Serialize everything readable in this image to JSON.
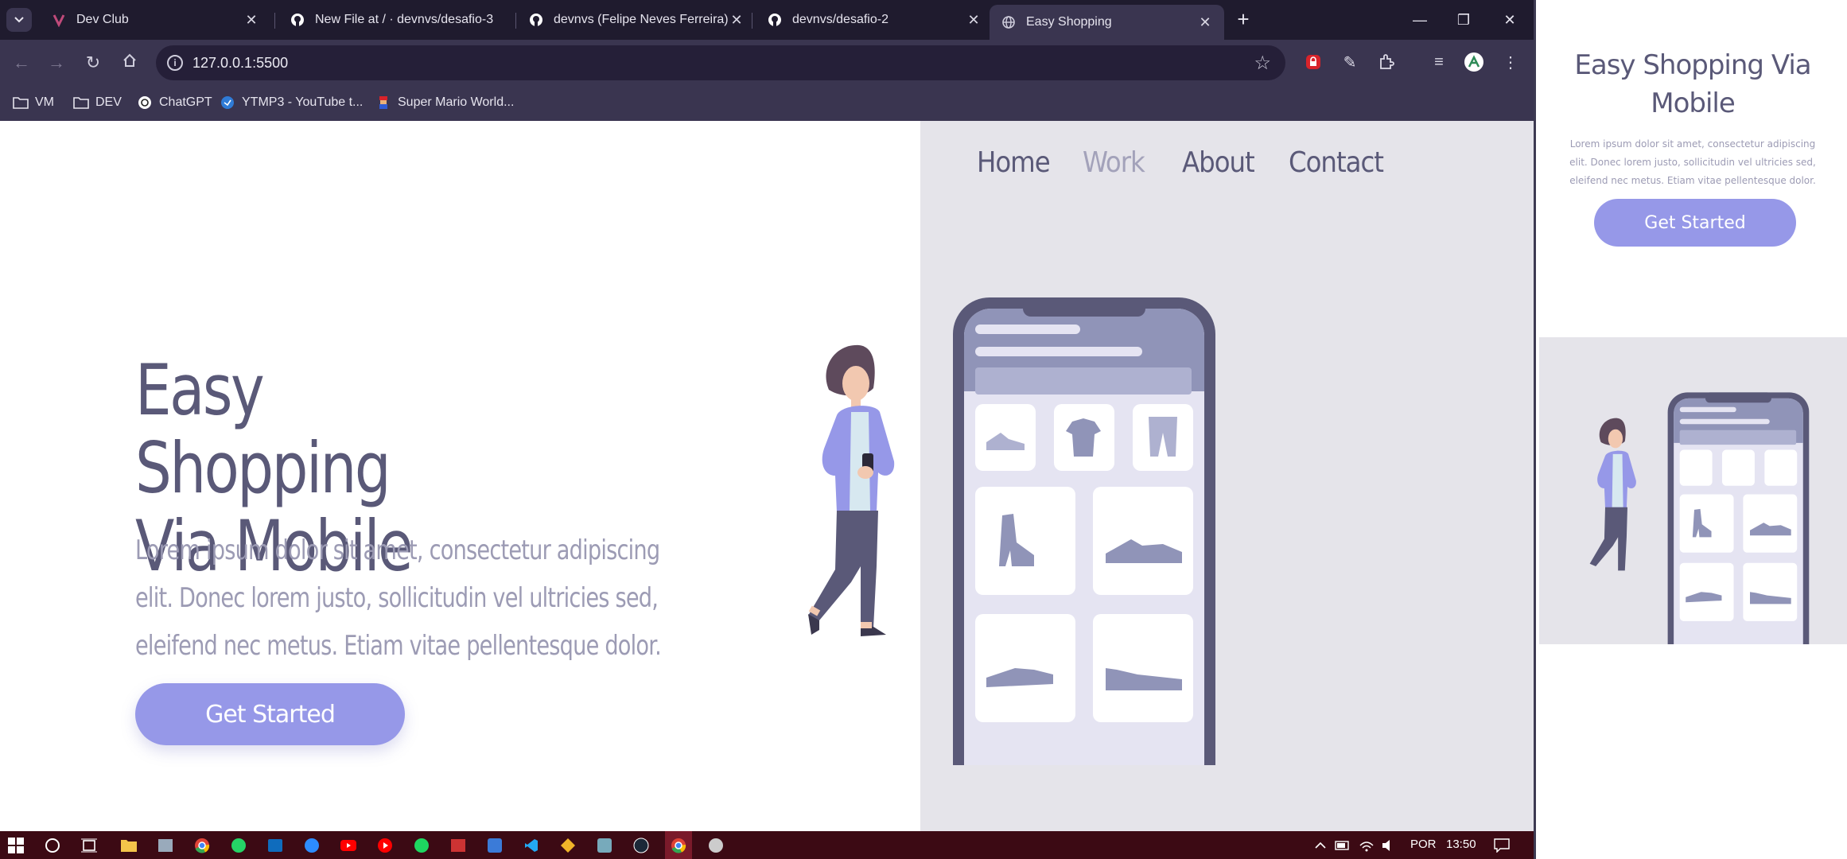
{
  "browser": {
    "tabs": [
      {
        "title": "Dev Club",
        "icon": "devclub-icon"
      },
      {
        "title": "New File at / · devnvs/desafio-3",
        "icon": "github-icon"
      },
      {
        "title": "devnvs (Felipe Neves Ferreira)",
        "icon": "github-icon"
      },
      {
        "title": "devnvs/desafio-2",
        "icon": "github-icon"
      },
      {
        "title": "Easy Shopping",
        "icon": "globe-icon",
        "active": true
      }
    ],
    "url": "127.0.0.1:5500",
    "bookmarks": [
      {
        "label": "VM",
        "icon": "folder-icon"
      },
      {
        "label": "DEV",
        "icon": "folder-icon"
      },
      {
        "label": "ChatGPT",
        "icon": "chatgpt-icon"
      },
      {
        "label": "YTMP3 - YouTube t...",
        "icon": "ytmp3-icon"
      },
      {
        "label": "Super Mario World...",
        "icon": "mario-icon"
      }
    ]
  },
  "page": {
    "nav": [
      "Home",
      "Work",
      "About",
      "Contact"
    ],
    "hero": {
      "title_line1": "Easy Shopping",
      "title_line2": "Via Mobile",
      "text": "Lorem ipsum dolor sit amet, consectetur adipiscing elit. Donec lorem justo, sollicitudin vel ultricies sed, eleifend nec metus. Etiam vitae pellentesque dolor.",
      "button": "Get Started"
    }
  },
  "mobile_preview": {
    "title": "Easy Shopping Via Mobile",
    "text": "Lorem ipsum dolor sit amet, consectetur adipiscing elit. Donec lorem justo, sollicitudin vel ultricies sed, eleifend nec metus. Etiam vitae pellentesque dolor.",
    "button": "Get Started"
  },
  "taskbar": {
    "language": "POR",
    "time": "13:50"
  },
  "colors": {
    "primary_text": "#5a5978",
    "muted_text": "#9c9bb4",
    "button": "#9698e8",
    "panel_bg": "#e5e4ea",
    "phone_frame": "#5a5978",
    "phone_header": "#9094b8",
    "taskbar": "#3c0a14"
  }
}
